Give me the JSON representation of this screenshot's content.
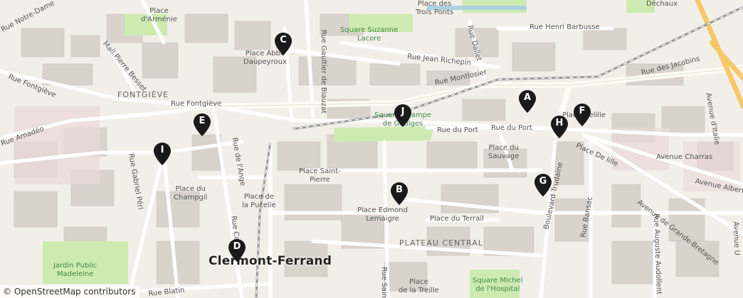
{
  "map": {
    "colors": {
      "background": "#f2efe9",
      "building": "#d9d3cc",
      "street": "#ffffff",
      "major_road": "#fbfbf0",
      "trunk": "#f7c86a",
      "park": "#cdebb0",
      "railway": "#9a9a9a",
      "marker": "#1a1a1a"
    },
    "labels": {
      "notre_dame": "Rue Notre-Dame",
      "place_armenie": "Place\nd'Arménie",
      "place_trois_ponts": "Place des\nTrois Ponts",
      "dechaux": "Déchaux",
      "rue_henri_barbusse": "Rue Henri Barbusse",
      "square_suzanne": "Square Suzanne\nLacore",
      "rue_gaultier": "Rue Gaultier de Biauzat",
      "place_abbe": "Place Abbé\nDaupeyroux",
      "rue_dallet": "Rue Dallet",
      "rue_jean_richepin": "Rue Jean Richepin",
      "mail_pierre_besset": "Mail Pierre Besset",
      "rue_fontgieve_w": "Rue Fontgiève",
      "fontgieve": "FONTGIÈVE",
      "rue_montlosier": "Rue Montlosier",
      "rue_des_jacobins": "Rue des Jacobins",
      "avenue_italie": "Avenue d'Italie",
      "rue_fontgieve": "Rue Fontgiève",
      "rue_amadeo": "Rue Amadéo",
      "square_jaude": "Square Champe\nde Gaulges",
      "place_delille": "Place Delille",
      "rue_du_port_1": "Rue du Port",
      "rue_du_port_2": "Rue du Port",
      "rue_de_lange": "Rue de l'Ange",
      "place_sauvage": "Place du\nSauvage",
      "place_de_lille": "Place De lille",
      "avenue_charras": "Avenue Charras",
      "rue_gabriel_peri": "Rue Gabriel Péri",
      "place_st_pierre": "Place Saint-\nPierre",
      "avenue_albert": "Avenue Albert et",
      "boulevard_trudaine": "Boulevard Trudaine",
      "place_champgil": "Place du\nChampgil",
      "place_pucelle": "Place de\nla Pucelle",
      "place_edmond": "Place Edmond\nLemaigre",
      "avenue_gde_bretagne": "Avenue de Grande-Bretagne",
      "rue_bansac": "Rue Bansac",
      "place_terrail": "Place du Terrail",
      "rue_ca": "Rue Ca",
      "plateau_central": "PLATEAU CENTRAL",
      "rue_auguste": "Rue Auguste Audollent",
      "avenue_u": "Avenue U",
      "jardin": "Jardin Public\nMadeleine",
      "city": "Clermont-Ferrand",
      "square_michel": "Square Michel\nde l'Hospital",
      "place_treille": "Place\nde la Treille",
      "rue_blatin": "Rue Blatin",
      "rue_sain": "Rue Sain"
    },
    "markers": [
      {
        "id": "C",
        "label": "C"
      },
      {
        "id": "A",
        "label": "A"
      },
      {
        "id": "J",
        "label": "J"
      },
      {
        "id": "F",
        "label": "F"
      },
      {
        "id": "H",
        "label": "H"
      },
      {
        "id": "E",
        "label": "E"
      },
      {
        "id": "I",
        "label": "I"
      },
      {
        "id": "G",
        "label": "G"
      },
      {
        "id": "B",
        "label": "B"
      },
      {
        "id": "D",
        "label": "D"
      }
    ],
    "attribution": {
      "symbol": "©",
      "text": "OpenStreetMap contributors"
    }
  }
}
